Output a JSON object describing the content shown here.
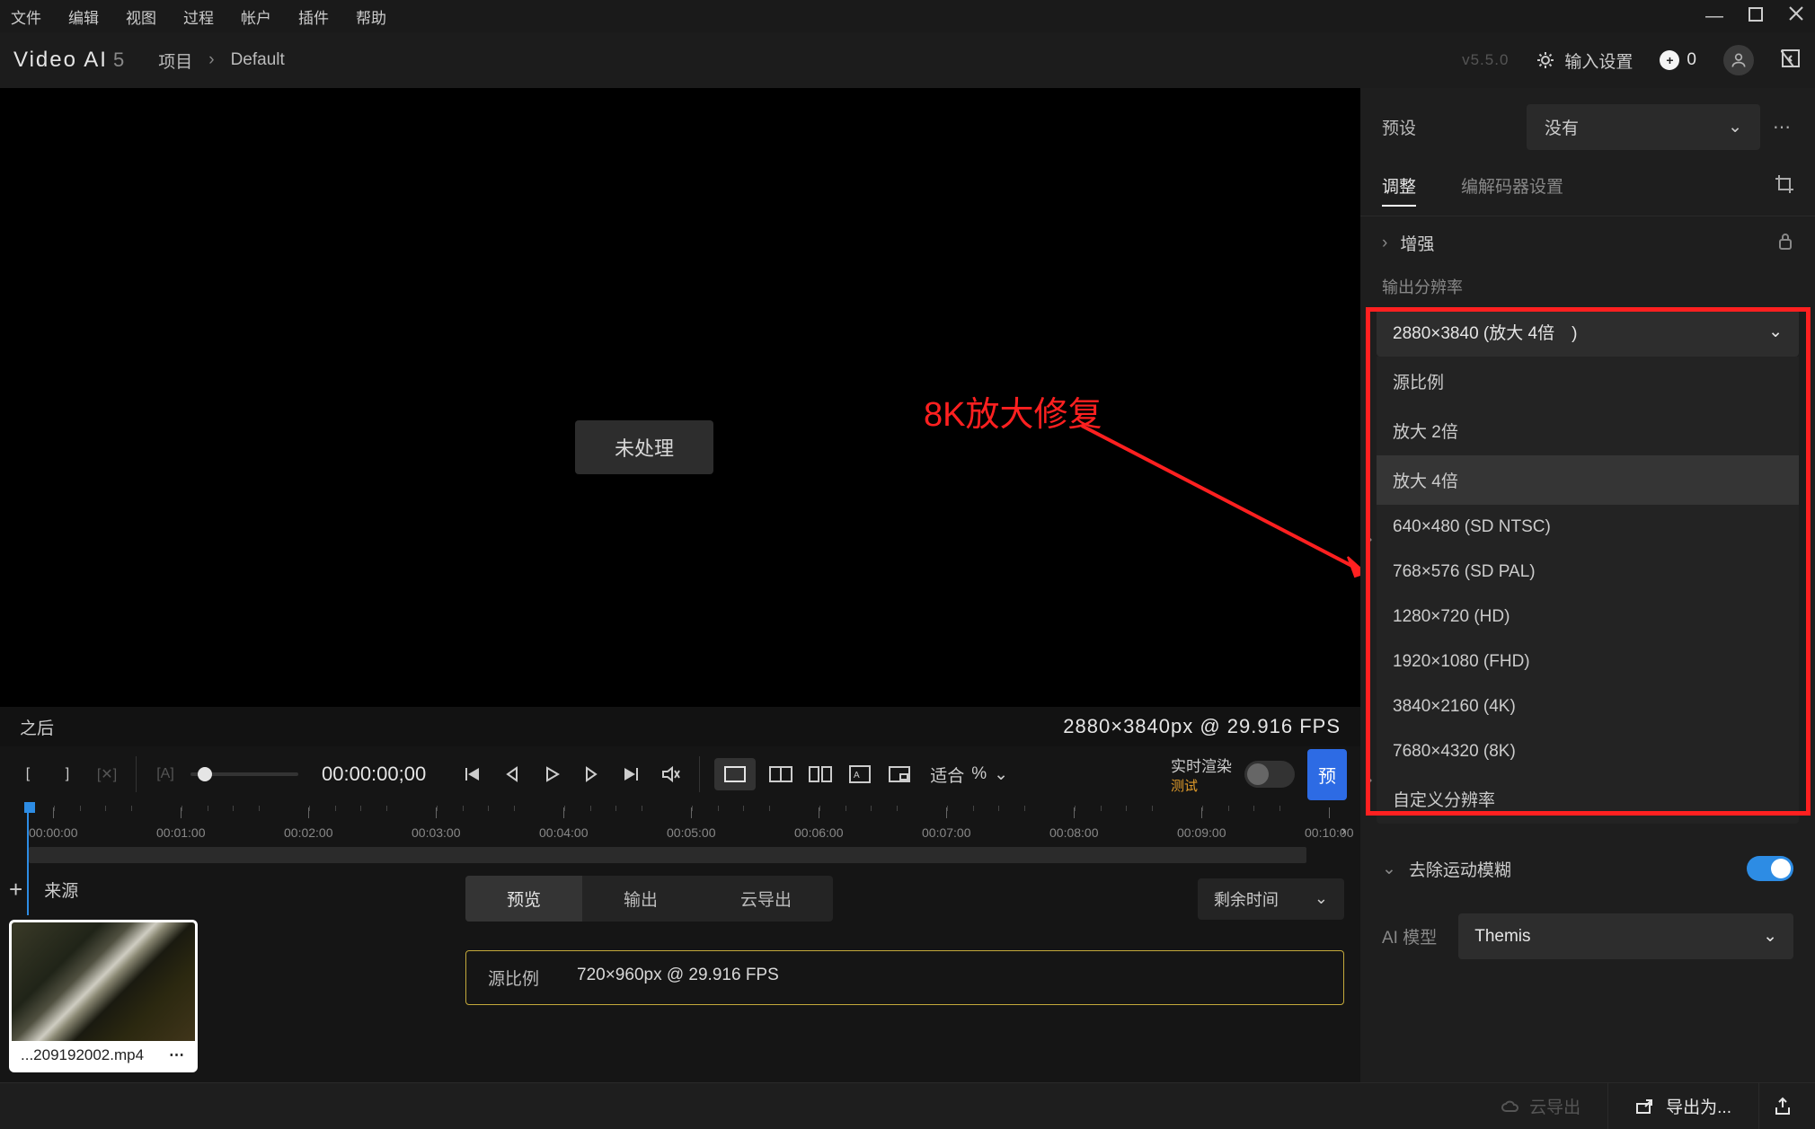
{
  "menubar": {
    "items": [
      "文件",
      "编辑",
      "视图",
      "过程",
      "帐户",
      "插件",
      "帮助"
    ]
  },
  "titlebar": {
    "app_name": "Video AI",
    "app_ver_digit": "5",
    "breadcrumb": [
      "项目",
      "Default"
    ],
    "version": "v5.5.0",
    "input_settings": "输入设置",
    "coin_count": "0"
  },
  "stage": {
    "pill_label": "未处理",
    "annotation": "8K放大修复"
  },
  "status": {
    "after_label": "之后",
    "resolution": "2880×3840px @ 29.916 FPS"
  },
  "controls": {
    "timecode": "00:00:00;00",
    "fit_label": "适合",
    "fit_pct": "%",
    "rt_render": "实时渲染",
    "rt_test": "测试",
    "preview_btn": "预"
  },
  "timeline": {
    "ticks": [
      "00:00:00",
      "00:01:00",
      "00:02:00",
      "00:03:00",
      "00:04:00",
      "00:05:00",
      "00:06:00",
      "00:07:00",
      "00:08:00",
      "00:09:00",
      "00:10:00"
    ]
  },
  "source": {
    "header": "来源",
    "tabs": {
      "preview": "预览",
      "output": "输出",
      "cloud": "云导出"
    },
    "remain": "剩余时间",
    "row": {
      "title": "源比例",
      "info": "720×960px @ 29.916 FPS"
    },
    "thumb_name": "...209192002.mp4"
  },
  "side": {
    "preset_label": "预设",
    "preset_value": "没有",
    "tab_adjust": "调整",
    "tab_codec": "编解码器设置",
    "enhance": "增强",
    "out_res_label": "输出分辨率",
    "out_res_value": "2880×3840 (放大 4倍　)",
    "dropdown": [
      "源比例",
      "放大 2倍",
      "放大 4倍",
      "640×480 (SD NTSC)",
      "768×576 (SD PAL)",
      "1280×720 (HD)",
      "1920×1080 (FHD)",
      "3840×2160 (4K)",
      "7680×4320 (8K)",
      "自定义分辨率"
    ],
    "deblur": "去除运动模糊",
    "ai_label": "AI 模型",
    "ai_value": "Themis"
  },
  "bottom": {
    "cloud": "云导出",
    "export": "导出为..."
  }
}
